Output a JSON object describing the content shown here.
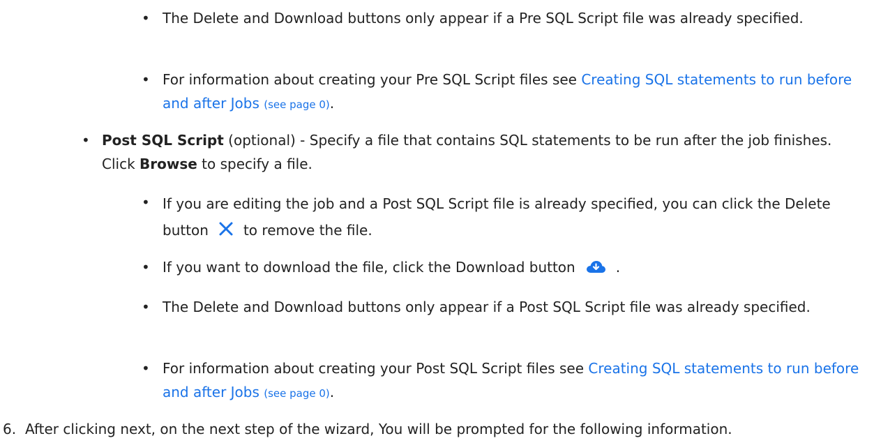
{
  "bullet_char": "•",
  "pre_sql": {
    "buttons_note": "The Delete and Download buttons only appear if a Pre SQL Script file was already specified.",
    "info_prefix": "For information about creating your Pre SQL Script files see ",
    "link_text": "Creating SQL statements to run before and after Jobs",
    "page_ref": "(see page 0)",
    "info_suffix": "."
  },
  "post_sql": {
    "label": "Post SQL Script",
    "label_rest": " (optional) - Specify a file that contains SQL statements to be run after the job finishes. Click ",
    "browse": "Browse",
    "browse_rest": " to specify a file.",
    "delete_text_before": "If you are editing the job and a Post SQL Script file is already specified, you can click the Delete button",
    "delete_text_after": "to remove the file.",
    "download_text_before": "If you want to download the file, click the Download button",
    "download_text_after": ".",
    "buttons_note": "The Delete and Download buttons only appear if a Post SQL Script file was already specified.",
    "info_prefix": "For information about creating your Post SQL Script files see ",
    "link_text": "Creating SQL statements to run before and after Jobs",
    "page_ref": "(see page 0)",
    "info_suffix": "."
  },
  "step6": {
    "number": "6.",
    "text": "After clicking next, on the next step of the wizard, You will be prompted for the following information."
  },
  "icons": {
    "delete": "close-icon",
    "download": "cloud-download-icon"
  },
  "colors": {
    "link": "#1a73e8",
    "icon": "#1a73e8",
    "text": "#222222"
  }
}
